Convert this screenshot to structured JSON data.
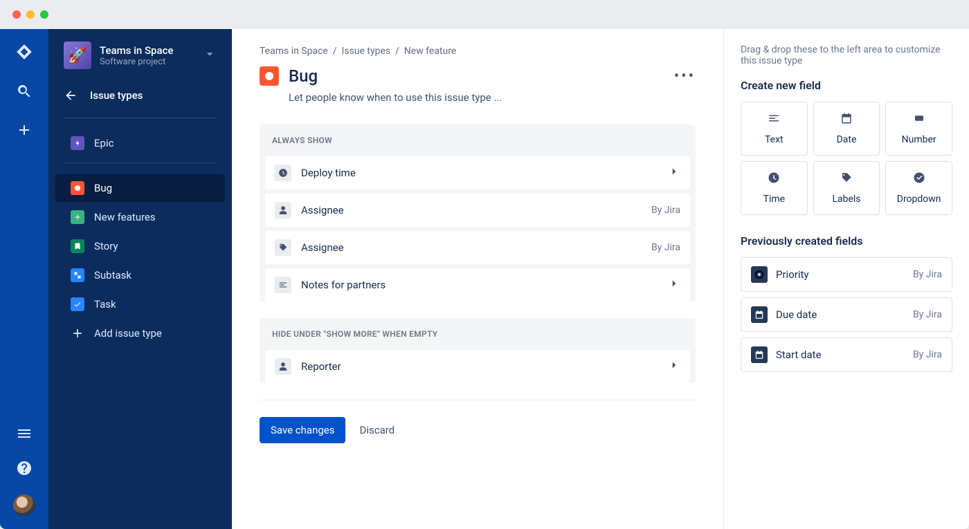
{
  "project": {
    "name": "Teams in Space",
    "subtitle": "Software project"
  },
  "backLabel": "Issue types",
  "nav": {
    "epic": "Epic",
    "bug": "Bug",
    "newFeatures": "New features",
    "story": "Story",
    "subtask": "Subtask",
    "task": "Task",
    "addIssueType": "Add issue type"
  },
  "breadcrumb": {
    "a": "Teams in Space",
    "b": "Issue types",
    "c": "New feature"
  },
  "page": {
    "title": "Bug",
    "description": "Let people know when to use this issue type ..."
  },
  "sections": {
    "always": {
      "header": "ALWAYS SHOW",
      "fields": [
        {
          "label": "Deploy time",
          "meta": "",
          "icon": "clock",
          "chevron": true
        },
        {
          "label": "Assignee",
          "meta": "By Jira",
          "icon": "person",
          "chevron": false
        },
        {
          "label": "Assignee",
          "meta": "By Jira",
          "icon": "tag",
          "chevron": false
        },
        {
          "label": "Notes for partners",
          "meta": "",
          "icon": "text",
          "chevron": true
        }
      ]
    },
    "hide": {
      "header": "HIDE UNDER \"SHOW MORE\" WHEN EMPTY",
      "fields": [
        {
          "label": "Reporter",
          "meta": "",
          "icon": "person",
          "chevron": true
        }
      ]
    }
  },
  "actions": {
    "save": "Save changes",
    "discard": "Discard"
  },
  "aside": {
    "hint": "Drag & drop these to the left area to customize this issue type",
    "createTitle": "Create new field",
    "fieldTypes": [
      {
        "label": "Text",
        "icon": "text"
      },
      {
        "label": "Date",
        "icon": "calendar"
      },
      {
        "label": "Number",
        "icon": "number"
      },
      {
        "label": "Time",
        "icon": "clock"
      },
      {
        "label": "Labels",
        "icon": "tag"
      },
      {
        "label": "Dropdown",
        "icon": "dropdown"
      }
    ],
    "prevTitle": "Previously created fields",
    "prevFields": [
      {
        "label": "Priority",
        "meta": "By Jira",
        "icon": "target"
      },
      {
        "label": "Due date",
        "meta": "By Jira",
        "icon": "calendar"
      },
      {
        "label": "Start date",
        "meta": "By Jira",
        "icon": "calendar"
      }
    ]
  }
}
